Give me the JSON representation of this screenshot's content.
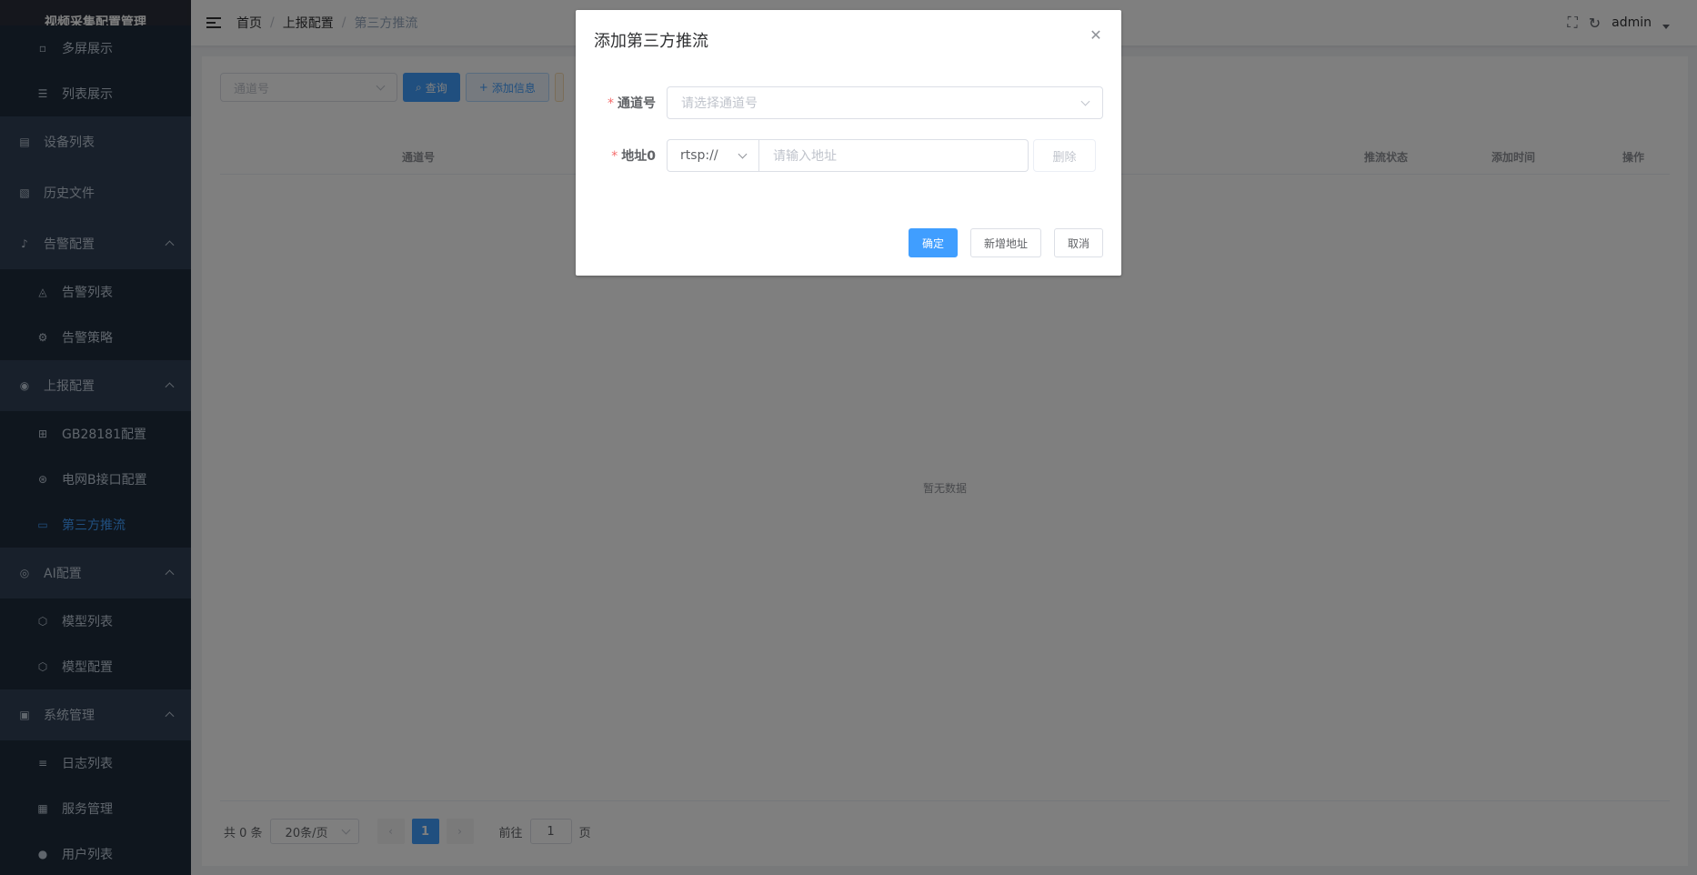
{
  "sidebar": {
    "title": "视频采集配置管理",
    "items": [
      {
        "label": "多屏展示",
        "icon": "grid-icon",
        "sub": true
      },
      {
        "label": "列表展示",
        "icon": "list-icon",
        "sub": true
      },
      {
        "label": "设备列表",
        "icon": "device-icon",
        "sub": false
      },
      {
        "label": "历史文件",
        "icon": "file-icon",
        "sub": false
      },
      {
        "label": "告警配置",
        "icon": "bell-icon",
        "sub": false,
        "expandable": true
      },
      {
        "label": "告警列表",
        "icon": "alarm-icon",
        "sub": true
      },
      {
        "label": "告警策略",
        "icon": "gear-icon",
        "sub": true
      },
      {
        "label": "上报配置",
        "icon": "report-icon",
        "sub": false,
        "expandable": true
      },
      {
        "label": "GB28181配置",
        "icon": "network-icon",
        "sub": true
      },
      {
        "label": "电网B接口配置",
        "icon": "grid-network-icon",
        "sub": true
      },
      {
        "label": "第三方推流",
        "icon": "video-icon",
        "sub": true,
        "active": true
      },
      {
        "label": "AI配置",
        "icon": "ai-icon",
        "sub": false,
        "expandable": true
      },
      {
        "label": "模型列表",
        "icon": "cube-icon",
        "sub": true
      },
      {
        "label": "模型配置",
        "icon": "cube-icon",
        "sub": true
      },
      {
        "label": "系统管理",
        "icon": "system-icon",
        "sub": false,
        "expandable": true
      },
      {
        "label": "日志列表",
        "icon": "log-icon",
        "sub": true
      },
      {
        "label": "服务管理",
        "icon": "apps-icon",
        "sub": true
      },
      {
        "label": "用户列表",
        "icon": "user-icon",
        "sub": true
      }
    ]
  },
  "navbar": {
    "breadcrumb": [
      "首页",
      "上报配置",
      "第三方推流"
    ],
    "username": "admin"
  },
  "toolbar": {
    "channel_placeholder": "通道号",
    "query_label": "查询",
    "add_label": "添加信息"
  },
  "table": {
    "columns": [
      "通道号",
      "推流状态",
      "添加时间",
      "操作"
    ],
    "empty_text": "暂无数据"
  },
  "pagination": {
    "total": "共 0 条",
    "page_size": "20条/页",
    "current": "1",
    "goto_prefix": "前往",
    "goto_value": "1",
    "goto_suffix": "页"
  },
  "dialog": {
    "title": "添加第三方推流",
    "channel_label": "通道号",
    "channel_placeholder": "请选择通道号",
    "address_label": "地址0",
    "protocol": "rtsp://",
    "address_placeholder": "请输入地址",
    "delete_label": "删除",
    "confirm_label": "确定",
    "add_address_label": "新增地址",
    "cancel_label": "取消"
  }
}
